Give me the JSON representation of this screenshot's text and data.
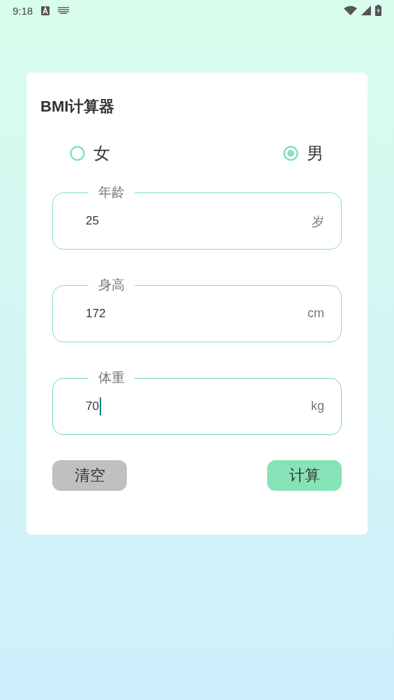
{
  "status_bar": {
    "time": "9:18"
  },
  "card": {
    "title": "BMI计算器",
    "genders": [
      {
        "label": "女",
        "selected": false
      },
      {
        "label": "男",
        "selected": true
      }
    ],
    "fields": [
      {
        "label": "年龄",
        "value": "25",
        "unit": "岁",
        "focused": false
      },
      {
        "label": "身高",
        "value": "172",
        "unit": "cm",
        "focused": false
      },
      {
        "label": "体重",
        "value": "70",
        "unit": "kg",
        "focused": true
      }
    ],
    "buttons": [
      {
        "label": "清空",
        "kind": "secondary"
      },
      {
        "label": "计算",
        "kind": "primary"
      }
    ]
  }
}
